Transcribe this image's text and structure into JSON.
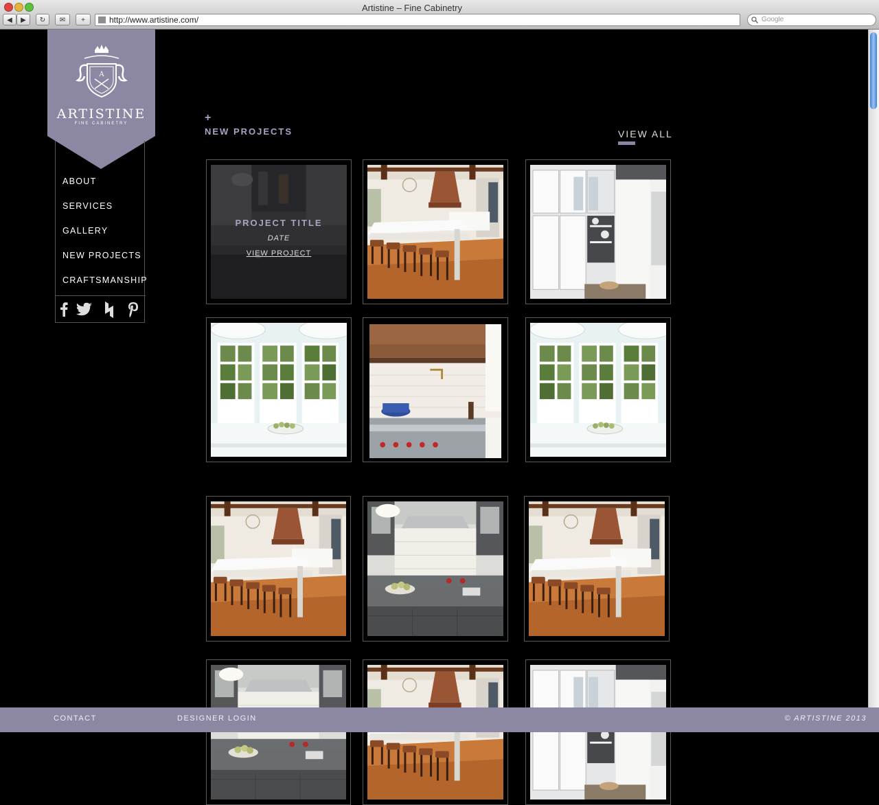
{
  "browser": {
    "window_title": "Artistine – Fine Cabinetry",
    "url": "http://www.artistine.com/",
    "search_placeholder": "Google",
    "toolbar_icons": [
      "back-icon",
      "forward-icon",
      "reload-icon",
      "bookmark-icon",
      "add-icon"
    ]
  },
  "brand": {
    "name": "ARTISTINE",
    "tagline": "FINE CABINETRY",
    "color": "#8c87a3"
  },
  "nav": {
    "items": [
      {
        "label": "ABOUT"
      },
      {
        "label": "SERVICES"
      },
      {
        "label": "GALLERY"
      },
      {
        "label": "NEW PROJECTS"
      },
      {
        "label": "CRAFTSMANSHIP"
      }
    ],
    "social_icons": [
      "facebook-icon",
      "twitter-icon",
      "houzz-icon",
      "pinterest-icon"
    ]
  },
  "main": {
    "plus_symbol": "+",
    "section_title": "NEW PROJECTS",
    "view_all_label": "VIEW ALL",
    "hover_card": {
      "title": "PROJECT TITLE",
      "date": "DATE",
      "link": "VIEW PROJECT"
    },
    "tiles": [
      {
        "image": "kitchen-white-cabinets-dark"
      },
      {
        "image": "kitchen-island-copper-hood"
      },
      {
        "image": "kitchen-glass-cabinets"
      },
      {
        "image": "kitchen-windows"
      },
      {
        "image": "kitchen-copper-hood-range"
      },
      {
        "image": "kitchen-windows"
      },
      {
        "image": "kitchen-island-copper-hood"
      },
      {
        "image": "kitchen-gray-island"
      },
      {
        "image": "kitchen-island-copper-hood"
      },
      {
        "image": "kitchen-gray-island"
      },
      {
        "image": "kitchen-island-copper-hood"
      },
      {
        "image": "kitchen-glass-cabinets"
      }
    ]
  },
  "footer": {
    "contact": "CONTACT",
    "designer_login": "DESIGNER LOGIN",
    "copyright": "© ARTISTINE 2013"
  }
}
